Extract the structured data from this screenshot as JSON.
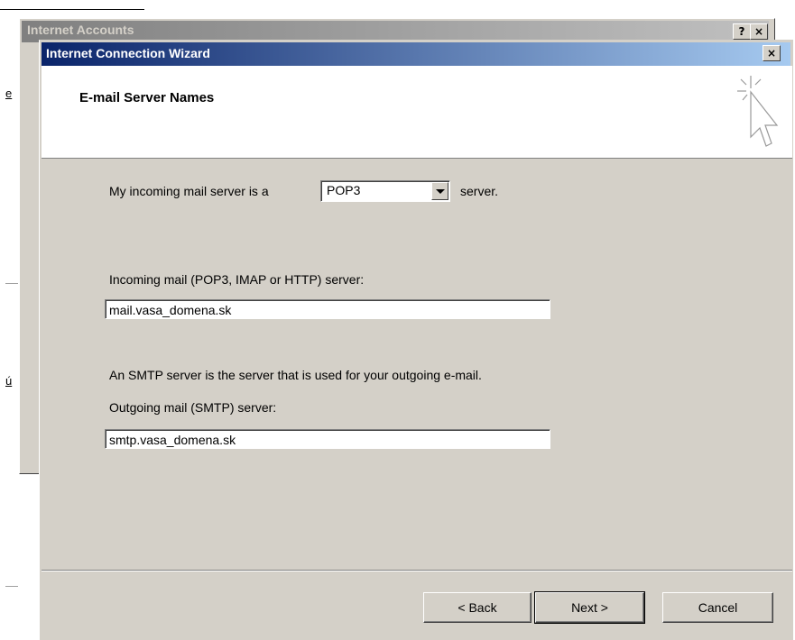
{
  "background_window": {
    "title": "Internet Accounts",
    "help_label": "?",
    "close_label": "×",
    "side_letters": [
      "e",
      "ú"
    ]
  },
  "wizard": {
    "title": "Internet Connection Wizard",
    "close_label": "×",
    "header_title": "E-mail Server Names",
    "incoming_type_prefix": "My incoming mail server is a",
    "incoming_type_value": "POP3",
    "incoming_type_suffix": "server.",
    "incoming_label": "Incoming mail (POP3, IMAP or HTTP) server:",
    "incoming_value": "mail.vasa_domena.sk",
    "smtp_info": "An SMTP server is the server that is used for your outgoing e-mail.",
    "outgoing_label": "Outgoing mail (SMTP) server:",
    "outgoing_value": "smtp.vasa_domena.sk",
    "buttons": {
      "back": "< Back",
      "next": "Next >",
      "cancel": "Cancel"
    }
  },
  "colors": {
    "titlebar_active": "#0a246a",
    "titlebar_inactive": "#808080",
    "face": "#d4d0c8"
  },
  "icons": {
    "header_icon": "cursor-sparkle-icon",
    "dropdown": "chevron-down-icon"
  }
}
